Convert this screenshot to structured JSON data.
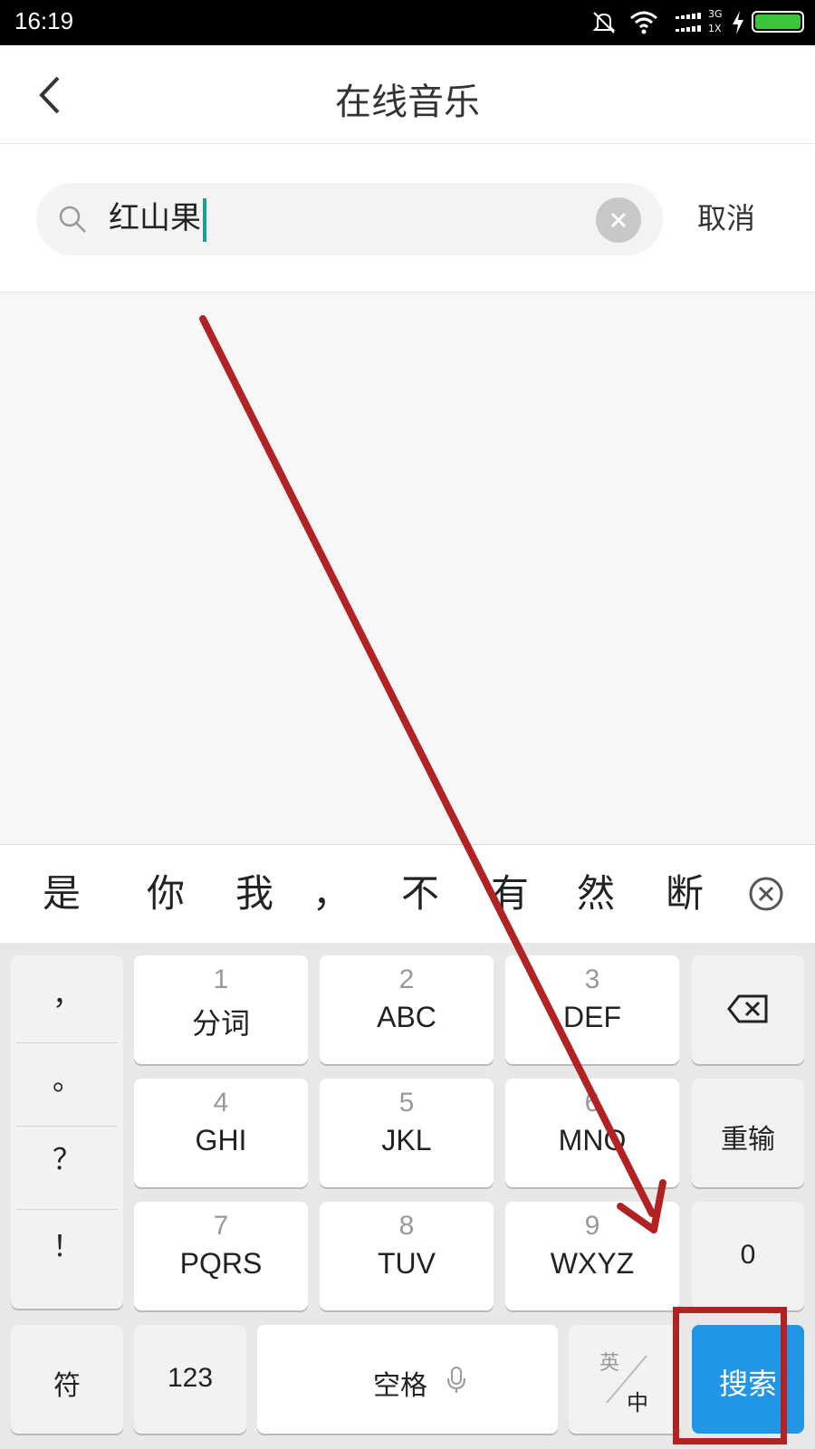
{
  "status_bar": {
    "time": "16:19",
    "network_top": "3G",
    "network_bottom": "1X",
    "icons": [
      "mute-icon",
      "wifi-icon",
      "signal-icon",
      "charging-icon",
      "battery-icon"
    ],
    "battery_color": "#3cc43c"
  },
  "header": {
    "title": "在线音乐",
    "back_icon": "chevron-left-icon"
  },
  "search": {
    "value": "红山果",
    "cancel_label": "取消",
    "caret_color": "#12a394"
  },
  "candidates": {
    "items": [
      "是",
      "你",
      "我",
      "，",
      "不",
      "有",
      "然",
      "断"
    ]
  },
  "keyboard": {
    "punctuation": [
      "，",
      "。",
      "？",
      "！"
    ],
    "keys": [
      {
        "num": "1",
        "letters": "分词"
      },
      {
        "num": "2",
        "letters": "ABC"
      },
      {
        "num": "3",
        "letters": "DEF"
      },
      {
        "num": "4",
        "letters": "GHI"
      },
      {
        "num": "5",
        "letters": "JKL"
      },
      {
        "num": "6",
        "letters": "MNO"
      },
      {
        "num": "7",
        "letters": "PQRS"
      },
      {
        "num": "8",
        "letters": "TUV"
      },
      {
        "num": "9",
        "letters": "WXYZ"
      }
    ],
    "reinput_label": "重输",
    "zero_label": "0",
    "symbols_label": "符",
    "numbers_label": "123",
    "space_label": "空格",
    "lang_en": "英",
    "lang_zh": "中",
    "search_label": "搜索",
    "search_color": "#2196e6"
  },
  "annotation": {
    "color": "#b22222"
  }
}
